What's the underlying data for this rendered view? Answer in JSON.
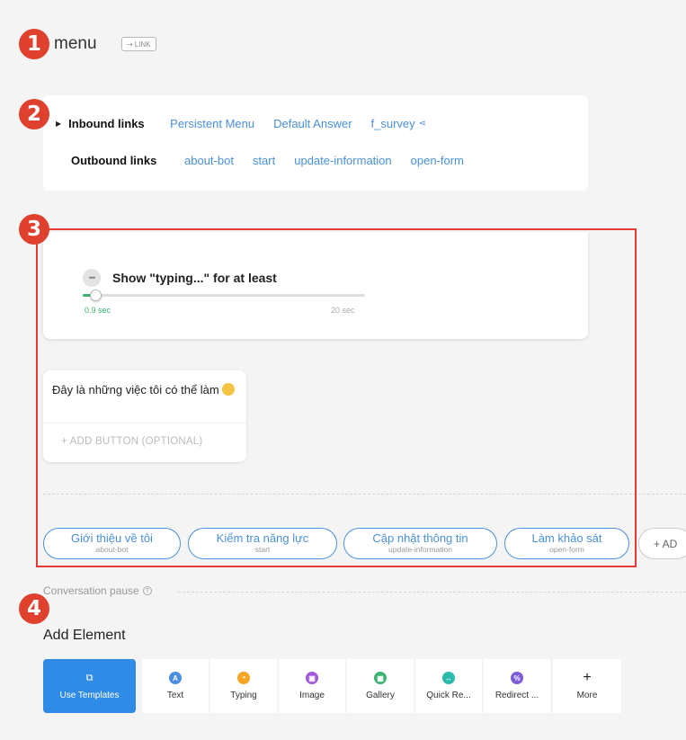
{
  "header": {
    "title": "menu",
    "link_tag": "LINK"
  },
  "badges": [
    "1",
    "2",
    "3",
    "4"
  ],
  "links": {
    "inbound_label": "Inbound links",
    "inbound": [
      "Persistent Menu",
      "Default Answer",
      "f_survey"
    ],
    "outbound_label": "Outbound links",
    "outbound": [
      "about-bot",
      "start",
      "update-information",
      "open-form"
    ]
  },
  "typing": {
    "title": "Show \"typing...\" for at least",
    "value_label": "0.9 sec",
    "max_label": "20 sec",
    "fraction": 0.045,
    "accent": "#3cb371"
  },
  "text_element": {
    "message": "Đây là những việc tôi có thể làm",
    "add_button": "+ ADD BUTTON (OPTIONAL)"
  },
  "quick_replies": [
    {
      "title": "Giới thiệu về tôi",
      "target": "about-bot"
    },
    {
      "title": "Kiểm tra năng lực",
      "target": "start"
    },
    {
      "title": "Cập nhật thông tin",
      "target": "update-information"
    },
    {
      "title": "Làm khảo sát",
      "target": "open-form"
    }
  ],
  "quick_reply_add": "+ AD",
  "pause": {
    "label": "Conversation pause"
  },
  "add_element": {
    "title": "Add Element",
    "tools": [
      {
        "label": "Use Templates",
        "icon": "template-icon"
      },
      {
        "label": "Text",
        "icon": "text-icon",
        "color": "#4a90e2",
        "glyph": "A"
      },
      {
        "label": "Typing",
        "icon": "typing-icon",
        "color": "#f5a623",
        "glyph": "•••"
      },
      {
        "label": "Image",
        "icon": "image-icon",
        "color": "#a259d9",
        "glyph": "▣"
      },
      {
        "label": "Gallery",
        "icon": "gallery-icon",
        "color": "#3cb371",
        "glyph": "▦"
      },
      {
        "label": "Quick Re...",
        "icon": "quick-reply-icon",
        "color": "#2bbbad",
        "glyph": "↔"
      },
      {
        "label": "Redirect ...",
        "icon": "redirect-icon",
        "color": "#7b5cd6",
        "glyph": "%"
      },
      {
        "label": "More",
        "icon": "plus-icon",
        "glyph": "+"
      }
    ]
  },
  "colors": {
    "link": "#4a90d9",
    "badge": "#e0402e",
    "frame": "#e53935",
    "primary": "#2f8be6"
  }
}
